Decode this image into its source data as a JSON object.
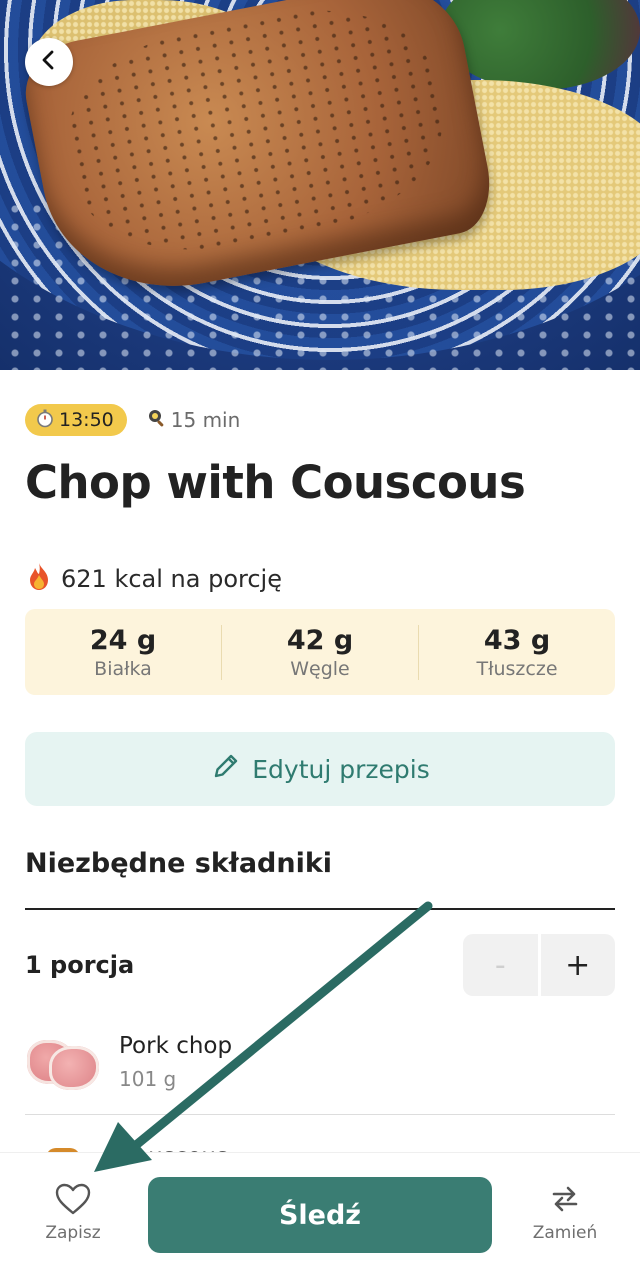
{
  "recipe": {
    "timer_time": "13:50",
    "prep_time": "15 min",
    "title": "Chop with Couscous",
    "kcal_text": "621 kcal na porcję",
    "macros": [
      {
        "value": "24 g",
        "label": "Białka"
      },
      {
        "value": "42 g",
        "label": "Węgle"
      },
      {
        "value": "43 g",
        "label": "Tłuszcze"
      }
    ],
    "edit_label": "Edytuj przepis"
  },
  "ingredients": {
    "section_title": "Niezbędne składniki",
    "portion_label": "1 porcja",
    "stepper": {
      "minus": "-",
      "plus": "+"
    },
    "items": [
      {
        "name": "Pork chop",
        "qty": "101 g"
      },
      {
        "name": "Couscous"
      }
    ]
  },
  "bottom_bar": {
    "save_label": "Zapisz",
    "track_label": "Śledź",
    "swap_label": "Zamień"
  },
  "colors": {
    "accent": "#3a7d73",
    "timer_pill": "#f2c94c",
    "macros_bg": "#fdf4dc",
    "edit_bg": "#e6f4f2",
    "annotation_arrow": "#2b6b63"
  },
  "icons": [
    "chevron-left-icon",
    "stopwatch-icon",
    "frying-pan-icon",
    "fire-icon",
    "pencil-icon",
    "heart-icon",
    "swap-arrows-icon"
  ]
}
